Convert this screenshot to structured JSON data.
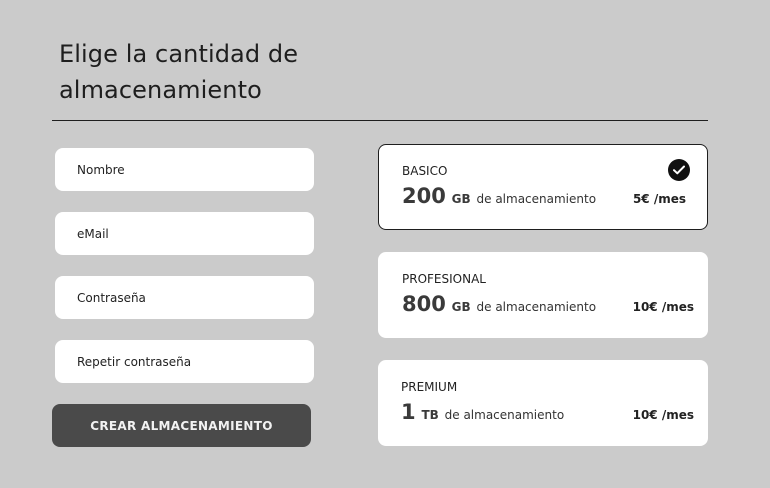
{
  "page": {
    "title": "Elige la cantidad de almacenamiento"
  },
  "form": {
    "name_placeholder": "Nombre",
    "email_placeholder": "eMail",
    "password_placeholder": "Contraseña",
    "repeat_password_placeholder": "Repetir contraseña",
    "submit_label": "CREAR ALMACENAMIENTO"
  },
  "plans": [
    {
      "name": "BASICO",
      "amount": "200",
      "unit": "GB",
      "description": "de almacenamiento",
      "price": "5€ /mes",
      "selected": true
    },
    {
      "name": "PROFESIONAL",
      "amount": "800",
      "unit": "GB",
      "description": "de almacenamiento",
      "price": "10€ /mes",
      "selected": false
    },
    {
      "name": "PREMIUM",
      "amount": "1",
      "unit": "TB",
      "description": "de almacenamiento",
      "price": "10€ /mes",
      "selected": false
    }
  ],
  "icons": {
    "selected_indicator": "check-circle-icon"
  },
  "colors": {
    "background": "#cbcbcb",
    "card": "#ffffff",
    "button": "#4a4a4a",
    "text": "#1e1e1e"
  }
}
